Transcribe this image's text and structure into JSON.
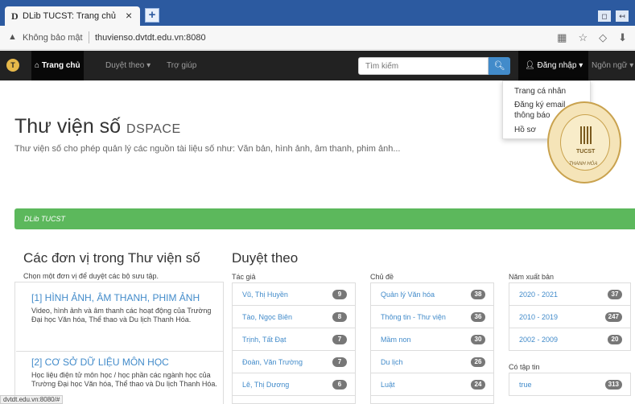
{
  "browser": {
    "tab_favicon": "D",
    "tab_title": "DLib TUCST: Trang chủ",
    "tab_close": "×",
    "new_tab": "+",
    "security_label": "Không bảo mật",
    "url": "thuvienso.dvtdt.edu.vn:8080",
    "status_url": "dvtdt.edu.vn:8080/#"
  },
  "navbar": {
    "logo_letter": "T",
    "home": "Trang chủ",
    "browse": "Duyệt theo ▾",
    "help": "Trợ giúp",
    "search_placeholder": "Tìm kiếm",
    "login": "Đăng nhập ▾",
    "language": "Ngôn ngữ ▾"
  },
  "dropdown": {
    "items": [
      "Trang cá nhân",
      "Đăng ký email",
      "thông báo",
      "Hồ sơ"
    ]
  },
  "hero": {
    "title": "Thư viện số",
    "title_suffix": "DSPACE",
    "description": "Thư viện số cho phép quản lý các nguồn tài liệu số như: Văn bản, hình ảnh, âm thanh, phim ảnh...",
    "seal_text": "TUCST",
    "seal_subtext": "THANH HÓA"
  },
  "breadcrumb": "DLib TUCST",
  "units": {
    "title": "Các đơn vị trong Thư viện số",
    "hint": "Chọn một đơn vị để duyệt các bộ sưu tập.",
    "items": [
      {
        "title": "[1] HÌNH ẢNH, ÂM THANH, PHIM ẢNH",
        "desc": "Video, hình ảnh và âm thanh các hoạt động của Trường Đại học Văn hóa, Thể thao và Du lịch Thanh Hóa."
      },
      {
        "title": "[2] CƠ SỞ DỮ LIỆU MÔN HỌC",
        "desc": "Học liệu điện tử môn học / học phần các ngành học của Trường Đại học Văn hóa, Thể thao và Du lịch Thanh Hóa."
      }
    ]
  },
  "browse": {
    "title": "Duyệt theo",
    "authors_label": "Tác giả",
    "authors": [
      {
        "name": "Vũ, Thị Huyền",
        "count": "9"
      },
      {
        "name": "Tào, Ngọc Biên",
        "count": "8"
      },
      {
        "name": "Trịnh, Tất Đạt",
        "count": "7"
      },
      {
        "name": "Đoàn, Văn Trường",
        "count": "7"
      },
      {
        "name": "Lê, Thị Dương",
        "count": "6"
      }
    ],
    "subjects_label": "Chủ đề",
    "subjects": [
      {
        "name": "Quản lý Văn hóa",
        "count": "38"
      },
      {
        "name": "Thông tin - Thư viện",
        "count": "36"
      },
      {
        "name": "Mầm non",
        "count": "30"
      },
      {
        "name": "Du lịch",
        "count": "26"
      },
      {
        "name": "Luật",
        "count": "24"
      }
    ],
    "years_label": "Năm xuất bản",
    "years": [
      {
        "name": "2020 - 2021",
        "count": "37"
      },
      {
        "name": "2010 - 2019",
        "count": "247"
      },
      {
        "name": "2002 - 2009",
        "count": "20"
      }
    ],
    "has_file_label": "Có tập tin",
    "has_file": [
      {
        "name": "true",
        "count": "313"
      }
    ]
  }
}
